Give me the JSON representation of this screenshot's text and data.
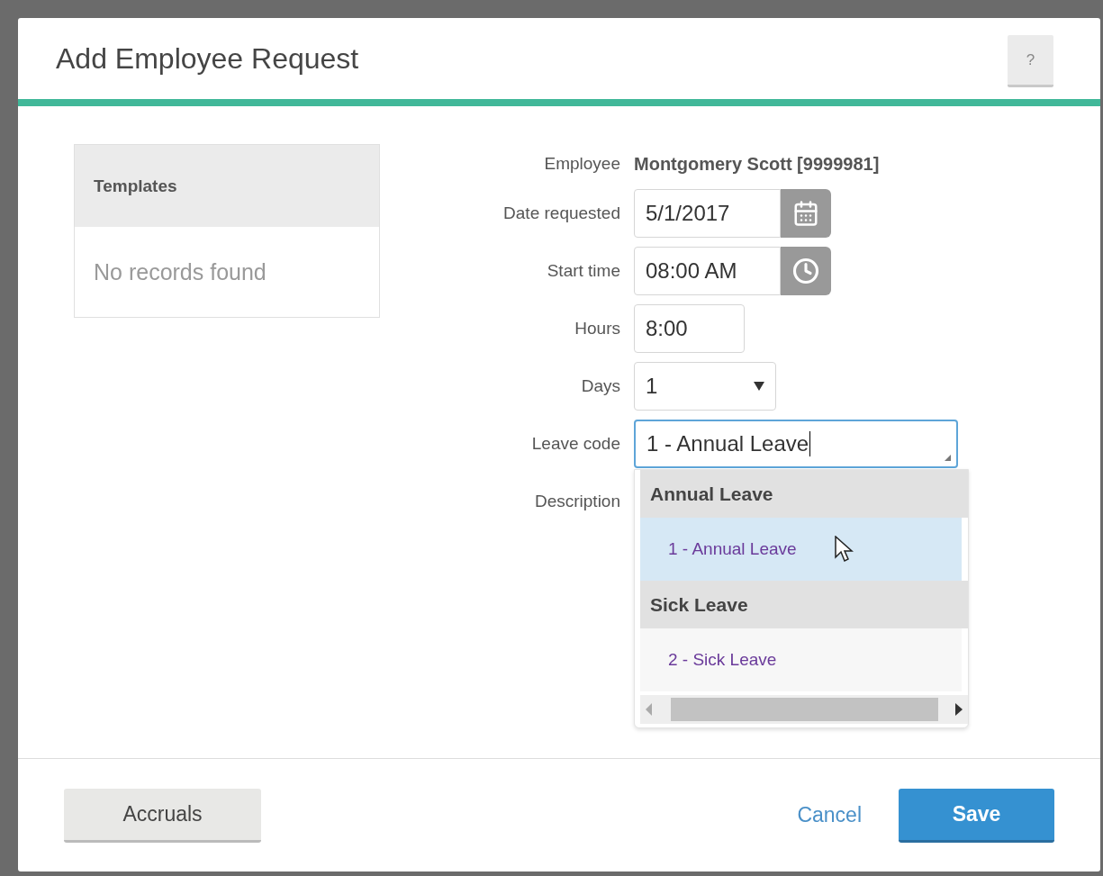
{
  "dialog": {
    "title": "Add Employee Request",
    "help_button": "?"
  },
  "templates": {
    "title": "Templates",
    "empty_text": "No records found"
  },
  "form": {
    "fields": [
      {
        "kind": "static",
        "label": "Employee",
        "value": "Montgomery Scott [9999981]"
      },
      {
        "kind": "date",
        "label": "Date requested",
        "value": "5/1/2017"
      },
      {
        "kind": "time",
        "label": "Start time",
        "value": "08:00 AM"
      },
      {
        "kind": "text",
        "label": "Hours",
        "value": "8:00"
      },
      {
        "kind": "select",
        "label": "Days",
        "value": "1"
      },
      {
        "kind": "combo",
        "label": "Leave code",
        "value": "1 - Annual Leave",
        "focused": true
      },
      {
        "kind": "label",
        "label": "Description"
      }
    ]
  },
  "dropdown": {
    "groups": [
      {
        "title": "Annual Leave",
        "items": [
          {
            "label": "1 - Annual Leave",
            "selected": true
          }
        ]
      },
      {
        "title": "Sick Leave",
        "items": [
          {
            "label": "2 - Sick Leave",
            "selected": false
          }
        ]
      }
    ]
  },
  "footer": {
    "accruals": "Accruals",
    "cancel": "Cancel",
    "save": "Save"
  }
}
